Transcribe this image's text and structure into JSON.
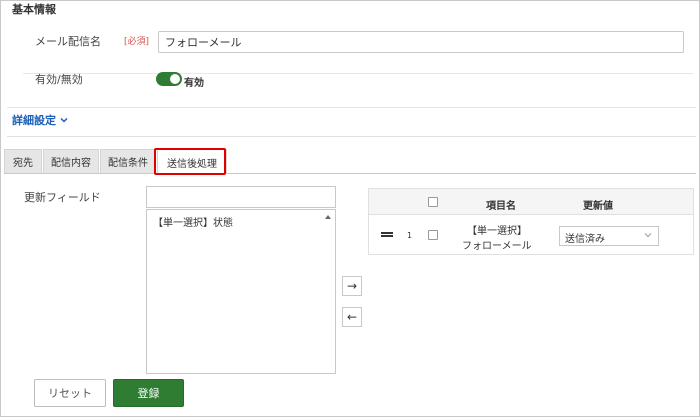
{
  "section": {
    "title": "基本情報"
  },
  "fields": {
    "name_label": "メール配信名",
    "required_badge": "[必須]",
    "name_value": "フォローメール",
    "enable_label": "有効/無効",
    "enable_state": "有効",
    "enabled": true
  },
  "advanced": {
    "label": "詳細設定"
  },
  "tabs": [
    {
      "label": "宛先",
      "active": false
    },
    {
      "label": "配信内容",
      "active": false
    },
    {
      "label": "配信条件",
      "active": false
    },
    {
      "label": "送信後処理",
      "active": true
    }
  ],
  "update": {
    "field_label": "更新フィールド",
    "filter_value": "",
    "options": [
      "【単一選択】状態"
    ]
  },
  "table": {
    "headers": {
      "name": "項目名",
      "value": "更新値"
    },
    "rows": [
      {
        "index": "1",
        "name_line1": "【単一選択】",
        "name_line2": "フォローメール",
        "value": "送信済み"
      }
    ]
  },
  "buttons": {
    "reset": "リセット",
    "save": "登録",
    "add": "→",
    "remove": "←"
  },
  "colors": {
    "accent_green": "#2e7d32",
    "link_blue": "#1a5fb4",
    "required_red": "#d9534f",
    "highlight_red": "#e00000"
  }
}
